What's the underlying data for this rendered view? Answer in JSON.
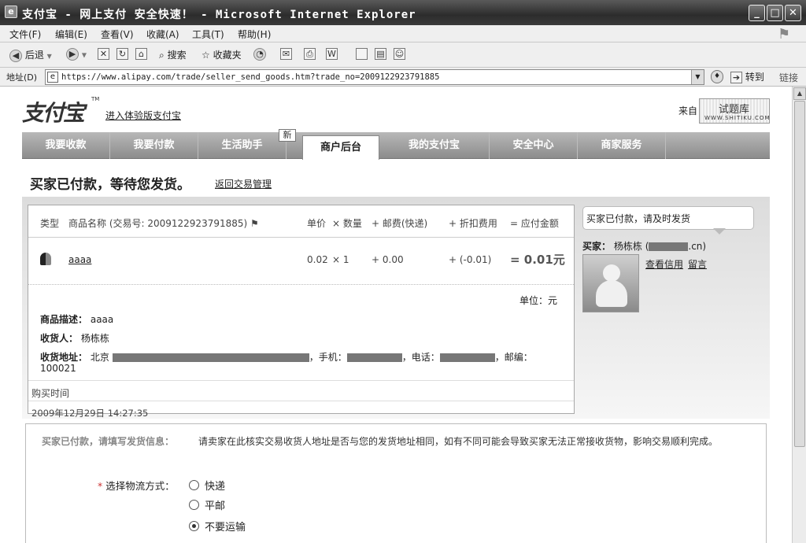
{
  "window": {
    "title": "支付宝 - 网上支付 安全快速！ - Microsoft Internet Explorer",
    "minimize": "_",
    "maximize": "□",
    "close": "✕"
  },
  "menu": [
    "文件(F)",
    "编辑(E)",
    "查看(V)",
    "收藏(A)",
    "工具(T)",
    "帮助(H)"
  ],
  "toolbar": {
    "back": "后退",
    "search": "搜索",
    "favorites": "收藏夹"
  },
  "address": {
    "label": "地址(D)",
    "url": "https://www.alipay.com/trade/seller_send_goods.htm?trade_no=2009122923791885",
    "go": "转到",
    "links": "链接"
  },
  "header": {
    "logo": "支付宝",
    "tm": "TM",
    "experience_link": "进入体验版支付宝",
    "source_label": "来自",
    "source_logo_big": "试题库",
    "source_logo_small": "WWW.SHITIKU.COM"
  },
  "nav": {
    "tabs": [
      "我要收款",
      "我要付款",
      "生活助手",
      "商户后台",
      "我的支付宝",
      "安全中心",
      "商家服务"
    ],
    "active_index": 3,
    "new_badge": "新"
  },
  "status": {
    "title": "买家已付款，等待您发货。",
    "back_link": "返回交易管理"
  },
  "order": {
    "headers": {
      "type": "类型",
      "name": "商品名称 (交易号: 2009122923791885)",
      "price": "单价",
      "qty": "× 数量",
      "postage": "+ 邮费(快递)",
      "discount": "+ 折扣费用",
      "total": "= 应付金额"
    },
    "item": {
      "name": "aaaa",
      "price": "0.02",
      "qty": "× 1",
      "postage": "+ 0.00",
      "discount": "+ (-0.01)",
      "total": "= 0.01元"
    },
    "unit": "单位：元",
    "description_label": "商品描述：",
    "description": "aaaa",
    "receiver_label": "收货人：",
    "receiver": "杨栋栋",
    "address_label": "收货地址：",
    "address_city": "北京",
    "mobile_label": "，手机：",
    "phone_label": "，电话：",
    "zip_label": "，邮编：",
    "zip": "100021",
    "purchase_time_label": "购买时间",
    "purchase_time": "2009年12月29日 14:27:35"
  },
  "buyer": {
    "bubble": "买家已付款，请及时发货",
    "label": "买家：",
    "name": "杨栋栋",
    "email_open": "(",
    "email_suffix": ".cn)",
    "credit_link": "查看信用",
    "message_link": "留言"
  },
  "shipping": {
    "heading": "买家已付款，请填写发货信息：",
    "note": "请卖家在此核实交易收货人地址是否与您的发货地址相同，如有不同可能会导致买家无法正常接收货物，影响交易顺利完成。",
    "required_mark": "*",
    "logistics_label": "选择物流方式：",
    "options": [
      "快递",
      "平邮",
      "不要运输"
    ],
    "selected_index": 2
  }
}
